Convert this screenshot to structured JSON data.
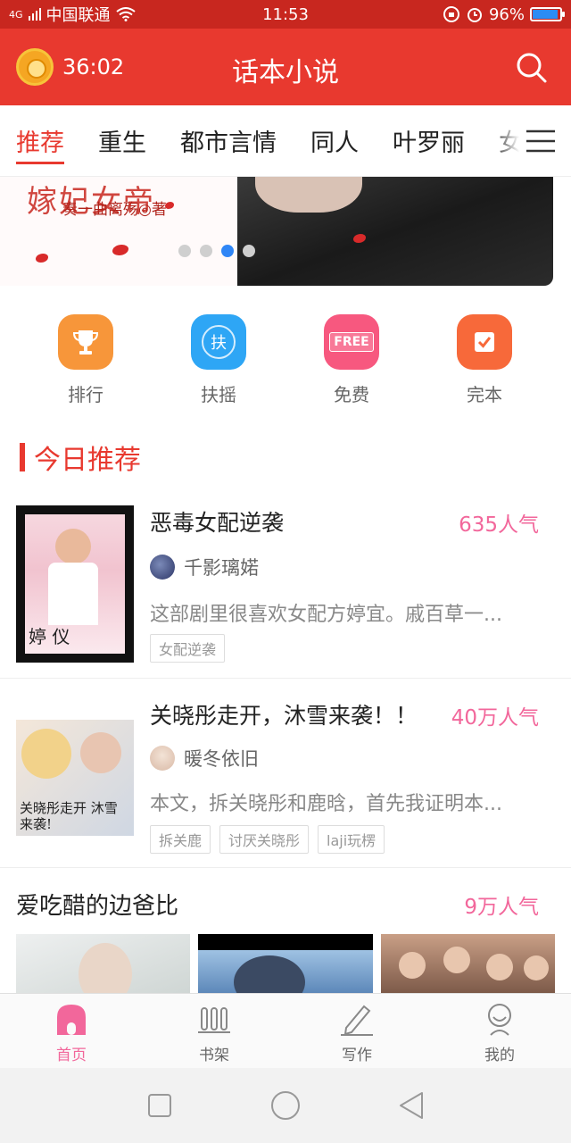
{
  "status_bar": {
    "network": "4G",
    "carrier": "中国联通",
    "time": "11:53",
    "battery": "96%",
    "battery_level": 0.96
  },
  "app_bar": {
    "timer": "36:02",
    "title": "话本小说"
  },
  "tabs": [
    "推荐",
    "重生",
    "都市言情",
    "同人",
    "叶罗丽",
    "女"
  ],
  "banner": {
    "title_art": "嫁妃女帝",
    "author_line": "奏一曲离殇◎著",
    "active_dot": 2,
    "dot_count": 4
  },
  "quick_actions": [
    {
      "label": "排行",
      "icon": "trophy-icon",
      "color": "#f7963a"
    },
    {
      "label": "扶摇",
      "icon": "fuyao-icon",
      "glyph": "扶",
      "color": "#2ea6f5"
    },
    {
      "label": "免费",
      "icon": "free-icon",
      "glyph": "FREE",
      "color": "#f7587f"
    },
    {
      "label": "完本",
      "icon": "complete-check-icon",
      "color": "#f7693a"
    }
  ],
  "section": {
    "title": "今日推荐"
  },
  "books": [
    {
      "title": "恶毒女配逆袭",
      "popularity": "635人气",
      "author": "千影璃婼",
      "desc": "这部剧里很喜欢女配方婷宜。戚百草一...",
      "tags": [
        "女配逆袭"
      ]
    },
    {
      "title": "关晓彤走开，沐雪来袭！！",
      "popularity": "40万人气",
      "author": "暖冬依旧",
      "desc": "本文，拆关晓彤和鹿晗，首先我证明本...",
      "tags": [
        "拆关鹿",
        "讨厌关晓彤",
        "laji玩楞"
      ],
      "cover_text": "关晓彤走开 沐雪来袭!"
    }
  ],
  "third_book": {
    "title": "爱吃醋的边爸比",
    "popularity": "9万人气"
  },
  "bottom_nav": [
    {
      "label": "首页",
      "icon": "home-icon",
      "active": true
    },
    {
      "label": "书架",
      "icon": "bookshelf-icon",
      "active": false
    },
    {
      "label": "写作",
      "icon": "pencil-icon",
      "active": false
    },
    {
      "label": "我的",
      "icon": "profile-icon",
      "active": false
    }
  ],
  "colors": {
    "primary_red": "#e8392f",
    "pink_accent": "#f2679b",
    "active_dot_blue": "#2f86f6"
  }
}
